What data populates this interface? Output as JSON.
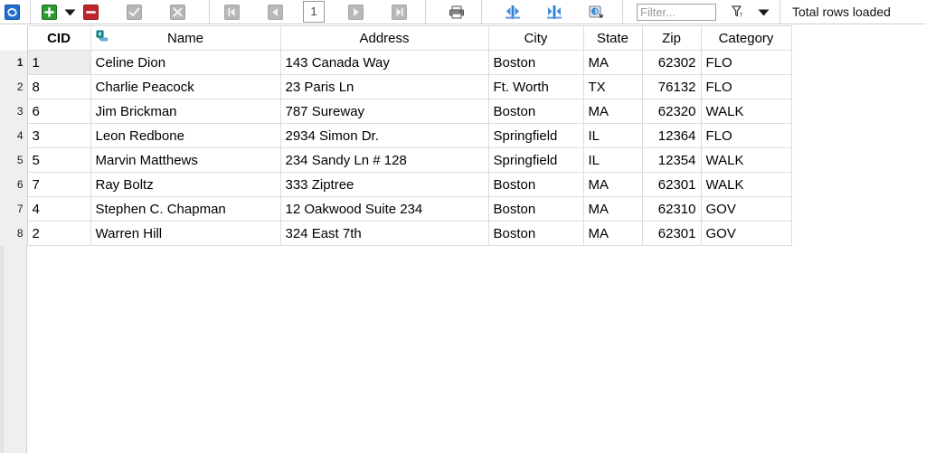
{
  "toolbar": {
    "groups": [
      {
        "name": "refresh-group",
        "buttons": [
          {
            "icon": "refresh-icon",
            "label": "Refresh",
            "enabled": true
          }
        ]
      },
      {
        "name": "edit-group",
        "buttons": [
          {
            "icon": "add-row-icon",
            "label": "Add Row",
            "enabled": true
          },
          {
            "icon": "chevron-down-icon",
            "label": "Add Row Options",
            "enabled": true
          },
          {
            "icon": "delete-row-icon",
            "label": "Delete Row",
            "enabled": true
          },
          {
            "icon": "commit-check-icon",
            "label": "Commit",
            "enabled": false
          },
          {
            "icon": "rollback-x-icon",
            "label": "Rollback",
            "enabled": false
          }
        ]
      },
      {
        "name": "navigation-group",
        "buttons": [
          {
            "icon": "first-page-icon",
            "label": "First Page",
            "enabled": false
          },
          {
            "icon": "previous-page-icon",
            "label": "Previous Page",
            "enabled": false
          },
          {
            "icon": "next-page-icon",
            "label": "Next Page",
            "enabled": false
          },
          {
            "icon": "last-page-icon",
            "label": "Last Page",
            "enabled": false
          }
        ],
        "page_number": "1"
      },
      {
        "name": "print-group",
        "buttons": [
          {
            "icon": "print-icon",
            "label": "Print",
            "enabled": true
          }
        ]
      },
      {
        "name": "column-group",
        "buttons": [
          {
            "icon": "expand-columns-icon",
            "label": "Expand Columns",
            "enabled": true
          },
          {
            "icon": "collapse-columns-icon",
            "label": "Collapse Columns",
            "enabled": true
          },
          {
            "icon": "export-data-icon",
            "label": "Export Data",
            "enabled": true
          }
        ]
      },
      {
        "name": "filter-group",
        "buttons": [
          {
            "icon": "filter-funnel-icon",
            "label": "Toggle Filter",
            "enabled": true
          },
          {
            "icon": "chevron-down-icon",
            "label": "Filter Options",
            "enabled": true
          }
        ]
      }
    ],
    "filter": {
      "value": "",
      "placeholder": "Filter..."
    },
    "status": "Total rows loaded"
  },
  "grid": {
    "columns": [
      {
        "key": "cid",
        "label": "CID",
        "primary_key": true,
        "align": "left",
        "has_index_icon": false
      },
      {
        "key": "name",
        "label": "Name",
        "primary_key": false,
        "align": "left",
        "has_index_icon": true,
        "index_icon": "index-key-icon"
      },
      {
        "key": "address",
        "label": "Address",
        "primary_key": false,
        "align": "left",
        "has_index_icon": false
      },
      {
        "key": "city",
        "label": "City",
        "primary_key": false,
        "align": "left",
        "has_index_icon": false
      },
      {
        "key": "state",
        "label": "State",
        "primary_key": false,
        "align": "left",
        "has_index_icon": false
      },
      {
        "key": "zip",
        "label": "Zip",
        "primary_key": false,
        "align": "right",
        "has_index_icon": false
      },
      {
        "key": "category",
        "label": "Category",
        "primary_key": false,
        "align": "left",
        "has_index_icon": false
      }
    ],
    "rows": [
      {
        "n": "1",
        "cid": "1",
        "name": "Celine Dion",
        "address": "143 Canada Way",
        "city": "Boston",
        "state": "MA",
        "zip": "62302",
        "category": "FLO"
      },
      {
        "n": "2",
        "cid": "8",
        "name": "Charlie Peacock",
        "address": "23 Paris Ln",
        "city": "Ft. Worth",
        "state": "TX",
        "zip": "76132",
        "category": "FLO"
      },
      {
        "n": "3",
        "cid": "6",
        "name": "Jim Brickman",
        "address": "787 Sureway",
        "city": "Boston",
        "state": "MA",
        "zip": "62320",
        "category": "WALK"
      },
      {
        "n": "4",
        "cid": "3",
        "name": "Leon Redbone",
        "address": "2934 Simon Dr.",
        "city": "Springfield",
        "state": "IL",
        "zip": "12364",
        "category": "FLO"
      },
      {
        "n": "5",
        "cid": "5",
        "name": "Marvin Matthews",
        "address": "234 Sandy Ln # 128",
        "city": "Springfield",
        "state": "IL",
        "zip": "12354",
        "category": "WALK"
      },
      {
        "n": "6",
        "cid": "7",
        "name": "Ray Boltz",
        "address": "333 Ziptree",
        "city": "Boston",
        "state": "MA",
        "zip": "62301",
        "category": "WALK"
      },
      {
        "n": "7",
        "cid": "4",
        "name": "Stephen C. Chapman",
        "address": "12 Oakwood Suite 234",
        "city": "Boston",
        "state": "MA",
        "zip": "62310",
        "category": "GOV"
      },
      {
        "n": "8",
        "cid": "2",
        "name": "Warren Hill",
        "address": "324 East 7th",
        "city": "Boston",
        "state": "MA",
        "zip": "62301",
        "category": "GOV"
      }
    ],
    "current_row_index": 0,
    "selected_cell": {
      "row": 0,
      "column": "cid"
    }
  },
  "colors": {
    "add": "#2e9b2e",
    "delete": "#c0272d",
    "refresh": "#1f6fd0",
    "index_icon": "#0f8e8e",
    "column_icon": "#2f7fd0",
    "selection": "#ececec",
    "gutter": "#efefef",
    "grid_line": "#dcdcdc"
  }
}
